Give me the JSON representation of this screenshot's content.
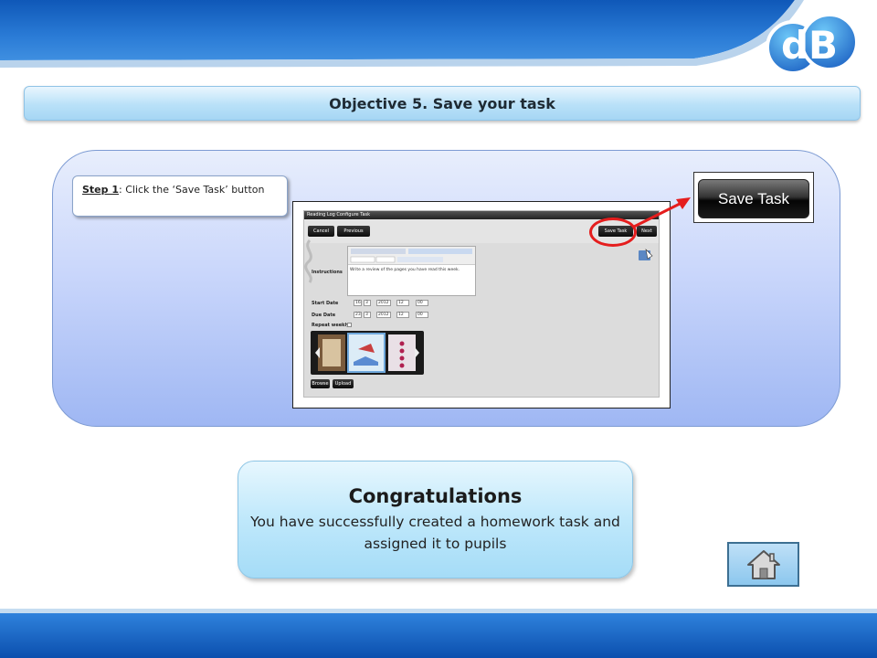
{
  "header": {
    "logo_text": "dB",
    "objective_title": "Objective 5.  Save your task"
  },
  "step": {
    "number": "Step 1",
    "separator": ":",
    "instruction": " Click the ‘Save Task’ button"
  },
  "screenshot": {
    "window_title": "Reading Log Configure Task",
    "buttons": {
      "cancel": "Cancel",
      "previous": "Previous",
      "save_task": "Save Task",
      "next": "Next",
      "browse": "Browse",
      "upload": "Upload"
    },
    "labels": {
      "instructions": "Instructions",
      "start_date": "Start Date",
      "due_date": "Due Date",
      "repeat_weekly": "Repeat weekly?"
    },
    "editor_font_placeholder": "Font",
    "editor_size_placeholder": "Size",
    "editor_text": "Write a review of the pages you have read this week.",
    "start_date": {
      "day": "16",
      "month": "3",
      "year": "2012",
      "hour": "12",
      "minute": "00"
    },
    "due_date": {
      "day": "23",
      "month": "3",
      "year": "2012",
      "hour": "12",
      "minute": "00"
    }
  },
  "zoom_button_label": "Save Task",
  "congrats": {
    "title": "Congratulations",
    "message": "You have successfully created a homework task and assigned it to pupils"
  },
  "colors": {
    "highlight": "#e51d1d",
    "band_blue": "#1d68c4"
  },
  "icons": {
    "home": "home-icon"
  }
}
